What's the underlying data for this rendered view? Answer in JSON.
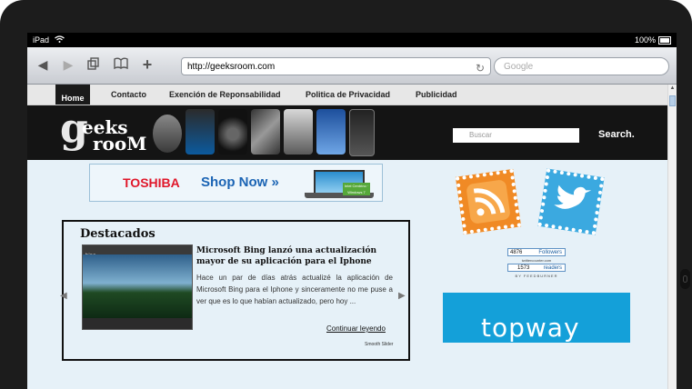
{
  "status_bar": {
    "device": "iPad",
    "battery": "100%"
  },
  "browser": {
    "url": "http://geeksroom.com",
    "search_placeholder": "Google",
    "icons": [
      "back-icon",
      "forward-icon",
      "tabs-icon",
      "bookmarks-icon",
      "add-icon",
      "reload-icon",
      "wifi-icon",
      "battery-icon"
    ]
  },
  "nav": {
    "items": [
      "Home",
      "Contacto",
      "Exención de Reponsabilidad",
      "Politica de Privacidad",
      "Publicidad"
    ]
  },
  "header": {
    "logo_line1": "eeks",
    "logo_line2": "rooM",
    "search_placeholder": "Buscar",
    "search_button": "Search."
  },
  "ads": {
    "toshiba": {
      "brand": "TOSHIBA",
      "cta": "Shop Now »",
      "sticker": "Intel Centrino · Windows 7"
    },
    "topway": {
      "text": "topway"
    }
  },
  "featured": {
    "section_title": "Destacados",
    "headline": "Microsoft Bing lanzó una actualización mayor de su aplicación para el Iphone",
    "excerpt": "Hace un par de días atrás actualizé la aplicación de Microsoft Bing para el Iphone y sinceramente no me puse a ver que es lo que habían actualizado, pero hoy ...",
    "read_more": "Continuar leyendo",
    "credit": "Smooth Slider",
    "image_label": "bing"
  },
  "social": {
    "followers_count": "4876",
    "followers_label": "Followers",
    "counter_site": "twittercounter.com",
    "readers_count": "1573",
    "readers_label": "readers",
    "feed_by": "BY FEEDBURNER"
  },
  "colors": {
    "page_bg": "#e6f1f8",
    "header_bg": "#141414",
    "toshiba_red": "#e0172a",
    "toshiba_blue": "#1b64b4",
    "rss_orange": "#f08a25",
    "twitter_blue": "#3ba9e0",
    "topway_bg": "#14a0d9"
  }
}
